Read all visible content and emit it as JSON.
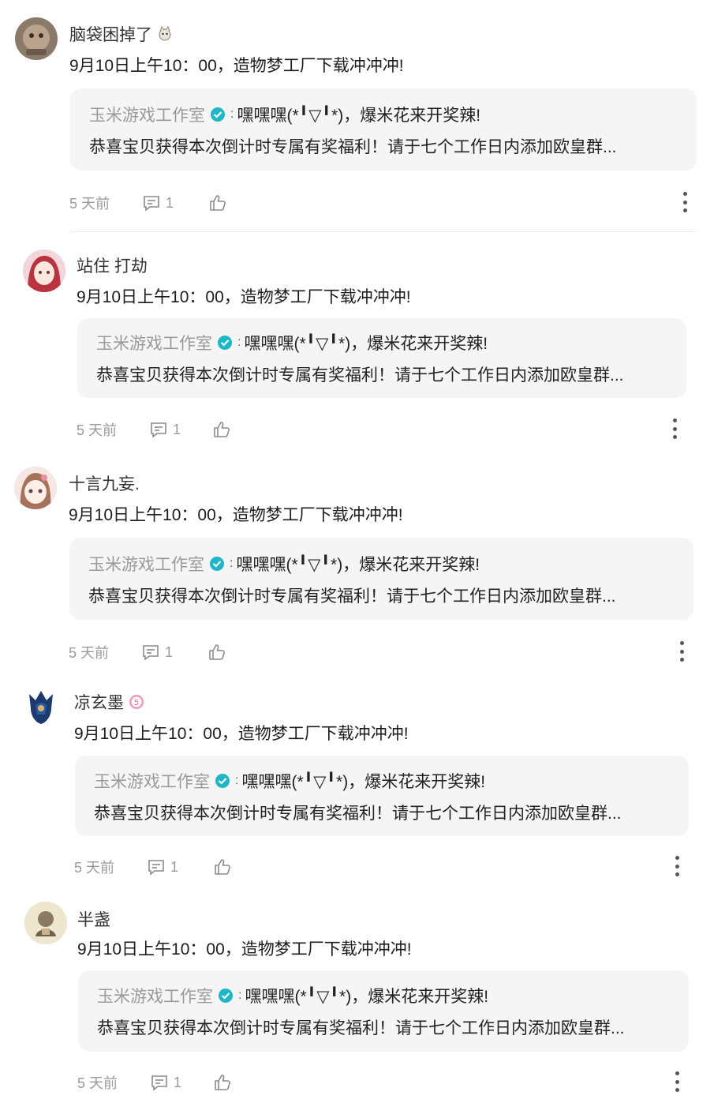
{
  "comments": [
    {
      "username": "脑袋困掉了",
      "badge_icon": "cat-emoji-icon",
      "text": "9月10日上午10：00，造物梦工厂下载冲冲冲!",
      "reply": {
        "author": "玉米游戏工作室",
        "colon": ":",
        "line1": "嘿嘿嘿(*╹▽╹*)，爆米花来开奖辣!",
        "line2": "恭喜宝贝获得本次倒计时专属有奖福利！请于七个工作日内添加欧皇群..."
      },
      "time": "5 天前",
      "reply_count": "1"
    },
    {
      "username": "站住 打劫",
      "badge_icon": "",
      "text": "9月10日上午10：00，造物梦工厂下载冲冲冲!",
      "reply": {
        "author": "玉米游戏工作室",
        "colon": ":",
        "line1": "嘿嘿嘿(*╹▽╹*)，爆米花来开奖辣!",
        "line2": "恭喜宝贝获得本次倒计时专属有奖福利！请于七个工作日内添加欧皇群..."
      },
      "time": "5 天前",
      "reply_count": "1"
    },
    {
      "username": "十言九妄.",
      "badge_icon": "",
      "text": "9月10日上午10：00，造物梦工厂下载冲冲冲!",
      "reply": {
        "author": "玉米游戏工作室",
        "colon": ":",
        "line1": "嘿嘿嘿(*╹▽╹*)，爆米花来开奖辣!",
        "line2": "恭喜宝贝获得本次倒计时专属有奖福利！请于七个工作日内添加欧皇群..."
      },
      "time": "5 天前",
      "reply_count": "1"
    },
    {
      "username": "凉玄墨",
      "badge_icon": "level-5-badge-icon",
      "text": "9月10日上午10：00，造物梦工厂下载冲冲冲!",
      "reply": {
        "author": "玉米游戏工作室",
        "colon": ":",
        "line1": "嘿嘿嘿(*╹▽╹*)，爆米花来开奖辣!",
        "line2": "恭喜宝贝获得本次倒计时专属有奖福利！请于七个工作日内添加欧皇群..."
      },
      "time": "5 天前",
      "reply_count": "1"
    },
    {
      "username": "半盏",
      "badge_icon": "",
      "text": "9月10日上午10：00，造物梦工厂下载冲冲冲!",
      "reply": {
        "author": "玉米游戏工作室",
        "colon": ":",
        "line1": "嘿嘿嘿(*╹▽╹*)，爆米花来开奖辣!",
        "line2": "恭喜宝贝获得本次倒计时专属有奖福利！请于七个工作日内添加欧皇群..."
      },
      "time": "5 天前",
      "reply_count": "1"
    }
  ],
  "colors": {
    "verified": "#1fb7c8",
    "reply_bg": "#f5f5f6",
    "muted": "#9a9a9a"
  }
}
